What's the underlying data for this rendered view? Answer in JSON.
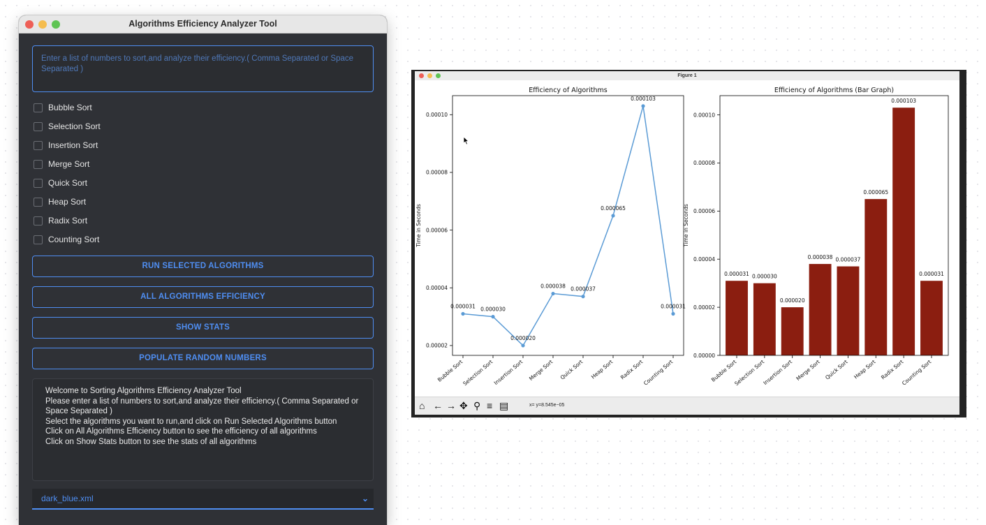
{
  "app": {
    "title": "Algorithms Efficiency Analyzer Tool",
    "input_placeholder": "Enter a list of numbers to sort,and analyze their efficiency.( Comma Separated or Space Separated )",
    "algorithms": [
      {
        "label": "Bubble Sort",
        "checked": false
      },
      {
        "label": "Selection Sort",
        "checked": false
      },
      {
        "label": "Insertion Sort",
        "checked": false
      },
      {
        "label": "Merge Sort",
        "checked": false
      },
      {
        "label": "Quick Sort",
        "checked": false
      },
      {
        "label": "Heap Sort",
        "checked": false
      },
      {
        "label": "Radix Sort",
        "checked": false
      },
      {
        "label": "Counting Sort",
        "checked": false
      }
    ],
    "buttons": {
      "run": "RUN SELECTED ALGORITHMS",
      "all": "ALL ALGORITHMS EFFICIENCY",
      "stats": "SHOW STATS",
      "populate": "POPULATE RANDOM NUMBERS"
    },
    "welcome_lines": [
      "Welcome to Sorting Algorithms Efficiency Analyzer Tool",
      "Please enter a list of numbers to sort,and analyze their efficiency.( Comma Separated or Space Separated )",
      "Select the algorithms you want to run,and click on Run Selected Algorithms button",
      "Click on All Algorithms Efficiency button to see the efficiency of all algorithms",
      "Click on Show Stats button to see the stats of all algorithms"
    ],
    "theme": {
      "selected": "dark_blue.xml"
    },
    "accent_color": "#4f8ef2"
  },
  "figure": {
    "title": "Figure 1",
    "status": "x= y=8.545e−05",
    "toolbar_icons": [
      "home-icon",
      "back-arrow-icon",
      "forward-arrow-icon",
      "pan-icon",
      "zoom-icon",
      "configure-subplots-icon",
      "save-icon"
    ]
  },
  "chart_data": [
    {
      "type": "line",
      "title": "Efficiency of Algorithms",
      "ylabel": "Time in Seconds",
      "categories": [
        "Bubble Sort",
        "Selection Sort",
        "Insertion Sort",
        "Merge Sort",
        "Quick Sort",
        "Heap Sort",
        "Radix Sort",
        "Counting Sort"
      ],
      "values": [
        3.1e-05,
        3e-05,
        2e-05,
        3.8e-05,
        3.7e-05,
        6.5e-05,
        0.000103,
        3.1e-05
      ],
      "labels": [
        "0.000031",
        "0.000030",
        "0.000020",
        "0.000038",
        "0.000037",
        "0.000065",
        "0.000103",
        "0.000031"
      ],
      "yticks": [
        2e-05,
        4e-05,
        6e-05,
        8e-05,
        0.0001
      ],
      "ytick_labels": [
        "0.00002",
        "0.00004",
        "0.00006",
        "0.00008",
        "0.00010"
      ],
      "ylim": [
        1.66e-05,
        0.0001066
      ],
      "color": "#5b9bd5",
      "grid": false
    },
    {
      "type": "bar",
      "title": "Efficiency of Algorithms (Bar Graph)",
      "ylabel": "Time in Seconds",
      "categories": [
        "Bubble Sort",
        "Selection Sort",
        "Insertion Sort",
        "Merge Sort",
        "Quick Sort",
        "Heap Sort",
        "Radix Sort",
        "Counting Sort"
      ],
      "values": [
        3.1e-05,
        3e-05,
        2e-05,
        3.8e-05,
        3.7e-05,
        6.5e-05,
        0.000103,
        3.1e-05
      ],
      "labels": [
        "0.000031",
        "0.000030",
        "0.000020",
        "0.000038",
        "0.000037",
        "0.000065",
        "0.000103",
        "0.000031"
      ],
      "yticks": [
        0,
        2e-05,
        4e-05,
        6e-05,
        8e-05,
        0.0001
      ],
      "ytick_labels": [
        "0.00000",
        "0.00002",
        "0.00004",
        "0.00006",
        "0.00008",
        "0.00010"
      ],
      "ylim": [
        0,
        0.000108
      ],
      "color": "#8b1e10",
      "grid": false
    }
  ]
}
